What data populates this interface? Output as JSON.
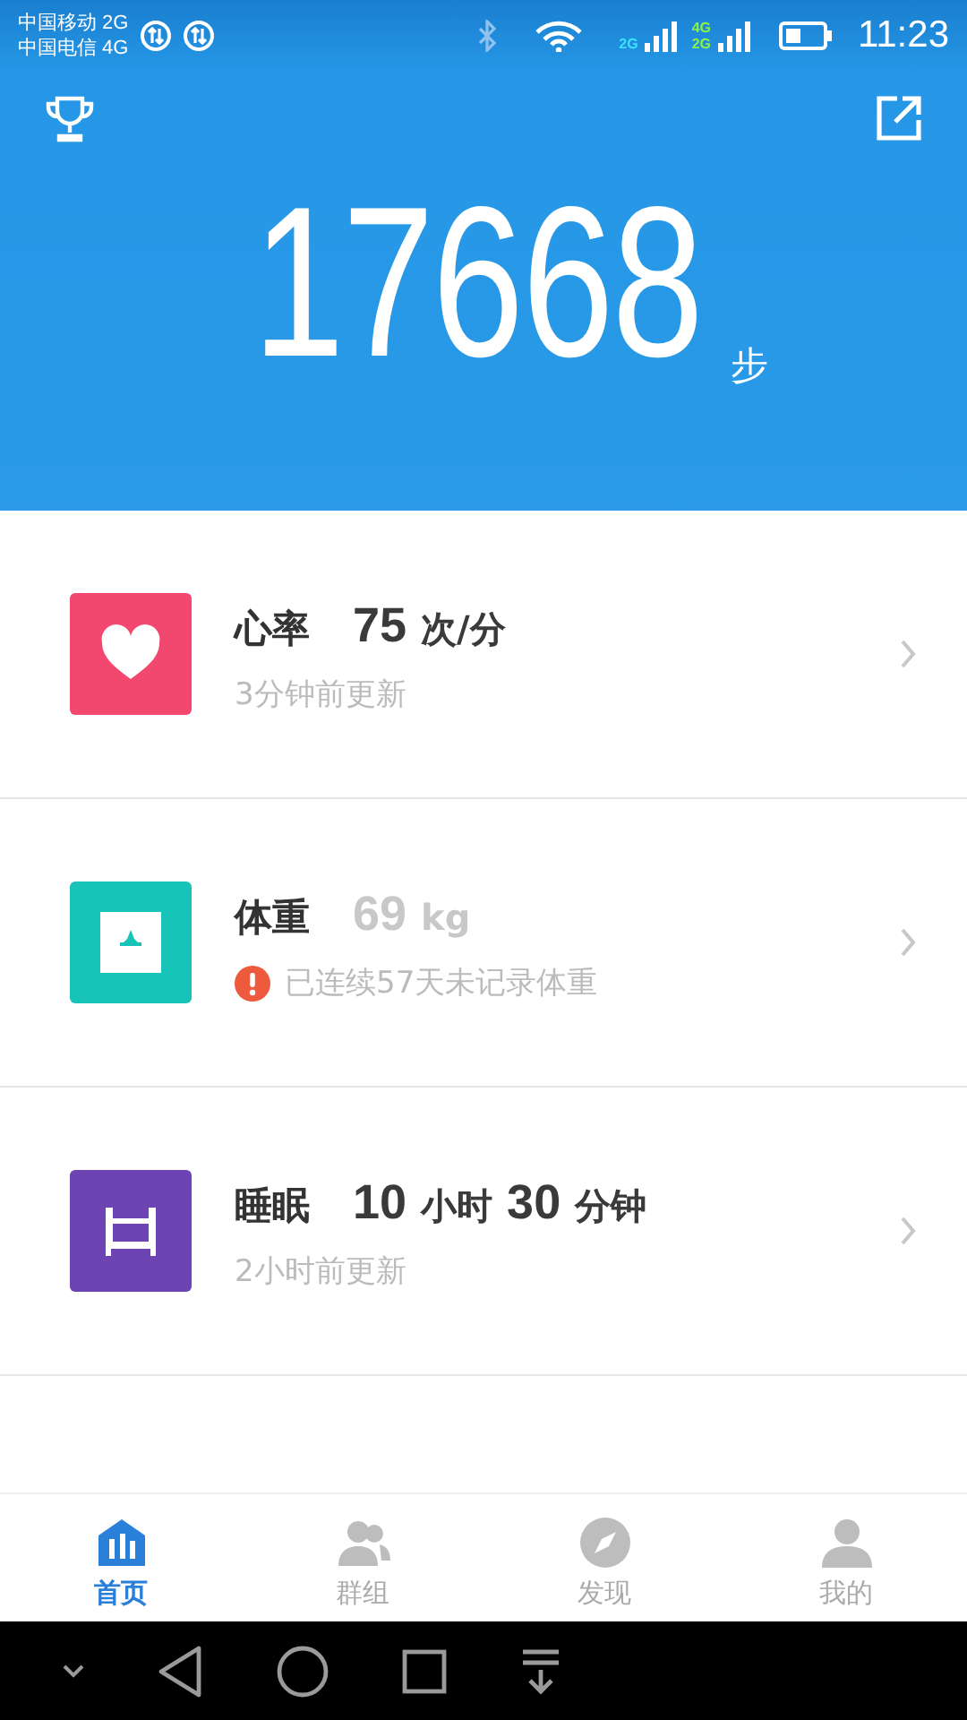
{
  "status_bar": {
    "carriers": [
      "中国移动 2G",
      "中国电信 4G"
    ],
    "signal_labels": [
      "2G",
      "4G",
      "2G"
    ],
    "time": "11:23"
  },
  "header": {
    "steps": "17668",
    "unit": "步"
  },
  "metrics": [
    {
      "kind": "heart",
      "title": "心率",
      "stale": false,
      "warning": false,
      "value": [
        {
          "text": "75",
          "kind": "number"
        },
        {
          "text": "次/分",
          "kind": "unit"
        }
      ],
      "note": "3分钟前更新"
    },
    {
      "kind": "weight",
      "title": "体重",
      "stale": true,
      "warning": true,
      "value": [
        {
          "text": "69",
          "kind": "number"
        },
        {
          "text": "kg",
          "kind": "unit"
        }
      ],
      "note": "已连续57天未记录体重"
    },
    {
      "kind": "sleep",
      "title": "睡眠",
      "stale": false,
      "warning": false,
      "value": [
        {
          "text": "10",
          "kind": "number"
        },
        {
          "text": "小时",
          "kind": "unit"
        },
        {
          "text": "30",
          "kind": "number"
        },
        {
          "text": "分钟",
          "kind": "unit"
        }
      ],
      "note": "2小时前更新"
    }
  ],
  "tabs": [
    {
      "kind": "home",
      "label": "首页",
      "selected": true
    },
    {
      "kind": "groups",
      "label": "群组",
      "selected": false
    },
    {
      "kind": "discover",
      "label": "发现",
      "selected": false
    },
    {
      "kind": "me",
      "label": "我的",
      "selected": false
    }
  ]
}
